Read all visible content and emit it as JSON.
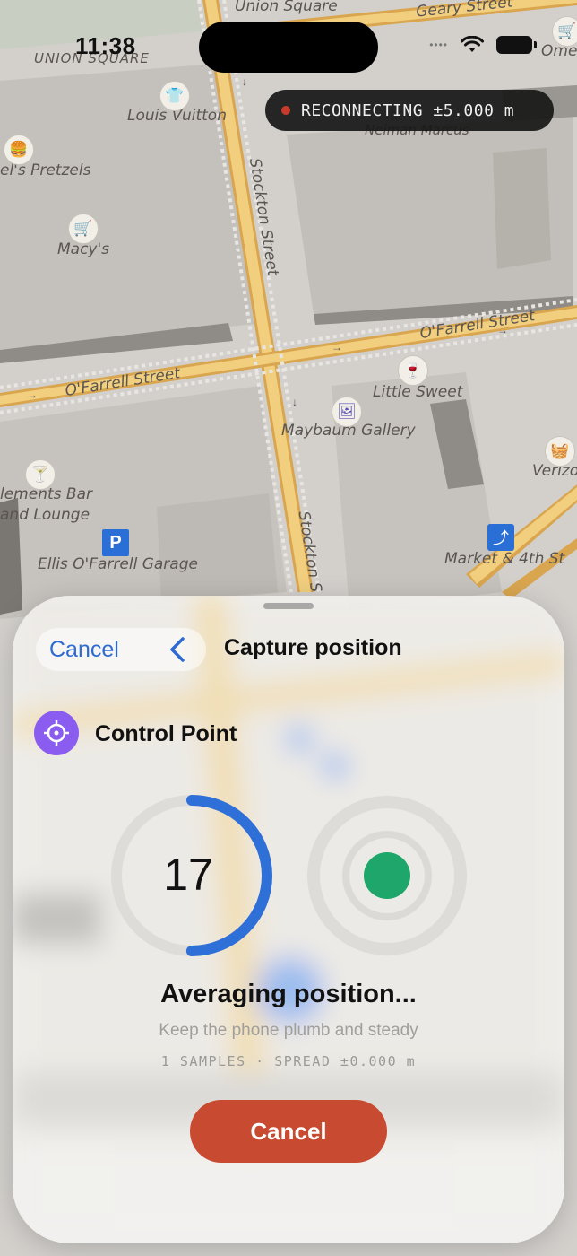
{
  "status_bar": {
    "time": "11:38"
  },
  "gps_banner": {
    "text": "RECONNECTING ±5.000 m",
    "dot_color": "#c63a2c"
  },
  "map": {
    "labels": {
      "union_square_top": "Union Square",
      "geary_street": "Geary Street",
      "union_square": "UNION SQUARE",
      "omega": "Ome",
      "louis_vuitton": "Louis Vuitton",
      "neiman_marcus": "Neiman Marcus",
      "pretzels": "el's Pretzels",
      "macys": "Macy's",
      "stockton_street_upper": "Stockton Street",
      "ofarrell_street_right": "O'Farrell Street",
      "ofarrell_street_left": "O'Farrell Street",
      "little_sweet": "Little Sweet",
      "maybaum_gallery": "Maybaum Gallery",
      "verizon": "Verizo",
      "elements_bar_1": "lements Bar",
      "elements_bar_2": "and Lounge",
      "ellis_garage": "Ellis O'Farrell Garage",
      "market_4th": "Market & 4th St",
      "stockton_street_lower": "Stockton S"
    },
    "icons": [
      "shopping-cart-icon",
      "shirt-icon",
      "burger-icon",
      "shopping-cart-icon",
      "wine-icon",
      "gallery-icon",
      "shopping-basket-icon",
      "cocktail-icon",
      "parking-icon",
      "escalator-icon"
    ],
    "colors": {
      "land": "#d3d0cc",
      "building": "#c4c0bb",
      "road": "#f1cf7e",
      "road_edge": "#d9a64f"
    }
  },
  "sheet": {
    "cancel_label": "Cancel",
    "title": "Capture position",
    "point_type": "Control Point",
    "countdown": "17",
    "countdown_progress": 0.5,
    "status_title": "Averaging position...",
    "status_subtitle": "Keep the phone plumb and steady",
    "stats": "1 SAMPLES · SPREAD ±0.000 m",
    "cancel_button": "Cancel",
    "colors": {
      "accent": "#2d6bd3",
      "progress": "#2f6fd8",
      "fix_dot": "#1fa66a",
      "cancel_button": "#c84a30",
      "point_icon": "#8a5cf0"
    }
  }
}
